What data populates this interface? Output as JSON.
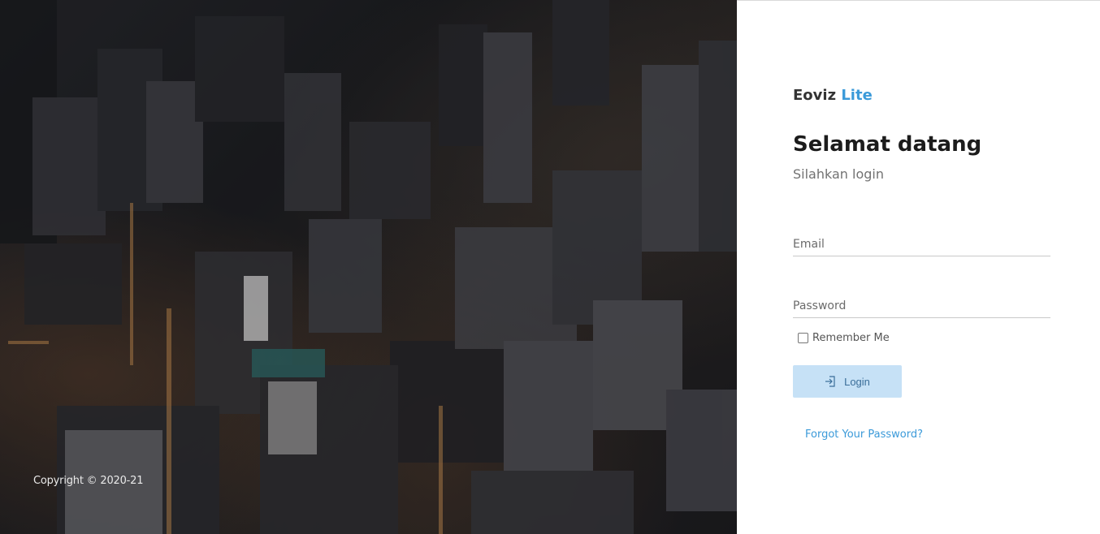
{
  "hero": {
    "copyright": "Copyright © 2020-21"
  },
  "brand": {
    "name": "Eoviz",
    "edition": "Lite",
    "accent_color": "#3b9ad9"
  },
  "login": {
    "title": "Selamat datang",
    "subtitle": "Silahkan login",
    "email_placeholder": "Email",
    "email_value": "",
    "password_placeholder": "Password",
    "password_value": "",
    "remember_label": "Remember Me",
    "remember_checked": false,
    "button_label": "Login",
    "button_icon": "sign-in-icon",
    "forgot_label": "Forgot Your Password?"
  }
}
